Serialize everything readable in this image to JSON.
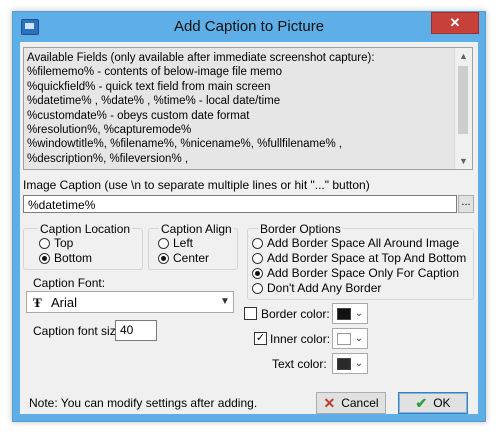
{
  "window": {
    "title": "Add Caption to Picture",
    "close_glyph": "✕",
    "app_icon": "app-screenshot-icon"
  },
  "fields": {
    "lines": [
      "Available Fields (only available after immediate screenshot capture):",
      "%filememo% - contents of below-image file memo",
      "%quickfield% - quick text field from main screen",
      "%datetime% , %date% , %time% - local date/time",
      "%customdate% - obeys custom date format",
      "%resolution%, %capturemode%",
      "%windowtitle%, %filename%, %nicename%, %fullfilename% ,",
      "%description%, %fileversion% ,"
    ]
  },
  "caption": {
    "label": "Image Caption (use \\n to separate multiple lines or hit \"...\" button)",
    "value": "%datetime%",
    "dots_label": "..."
  },
  "location": {
    "legend": "Caption Location",
    "options": [
      "Top",
      "Bottom"
    ],
    "selected": "Bottom"
  },
  "align": {
    "legend": "Caption Align",
    "options": [
      "Left",
      "Center"
    ],
    "selected": "Center"
  },
  "border": {
    "legend": "Border Options",
    "options": [
      "Add Border Space All Around Image",
      "Add Border Space at Top And Bottom",
      "Add Border Space Only For Caption",
      "Don't Add Any Border"
    ],
    "selected": "Add Border Space Only For Caption"
  },
  "font": {
    "label": "Caption Font:",
    "value": "Arial",
    "icon": "truetype-font-icon"
  },
  "font_size": {
    "label": "Caption font size:",
    "value": "40"
  },
  "colors": {
    "border_label": "Border color:",
    "border_checked": false,
    "border_color": "#000000",
    "inner_label": "Inner color:",
    "inner_checked": true,
    "inner_color": "#ffffff",
    "text_label": "Text color:",
    "text_color": "#2a2a2a"
  },
  "note": "Note: You can modify settings after adding.",
  "buttons": {
    "cancel": "Cancel",
    "ok": "OK"
  }
}
